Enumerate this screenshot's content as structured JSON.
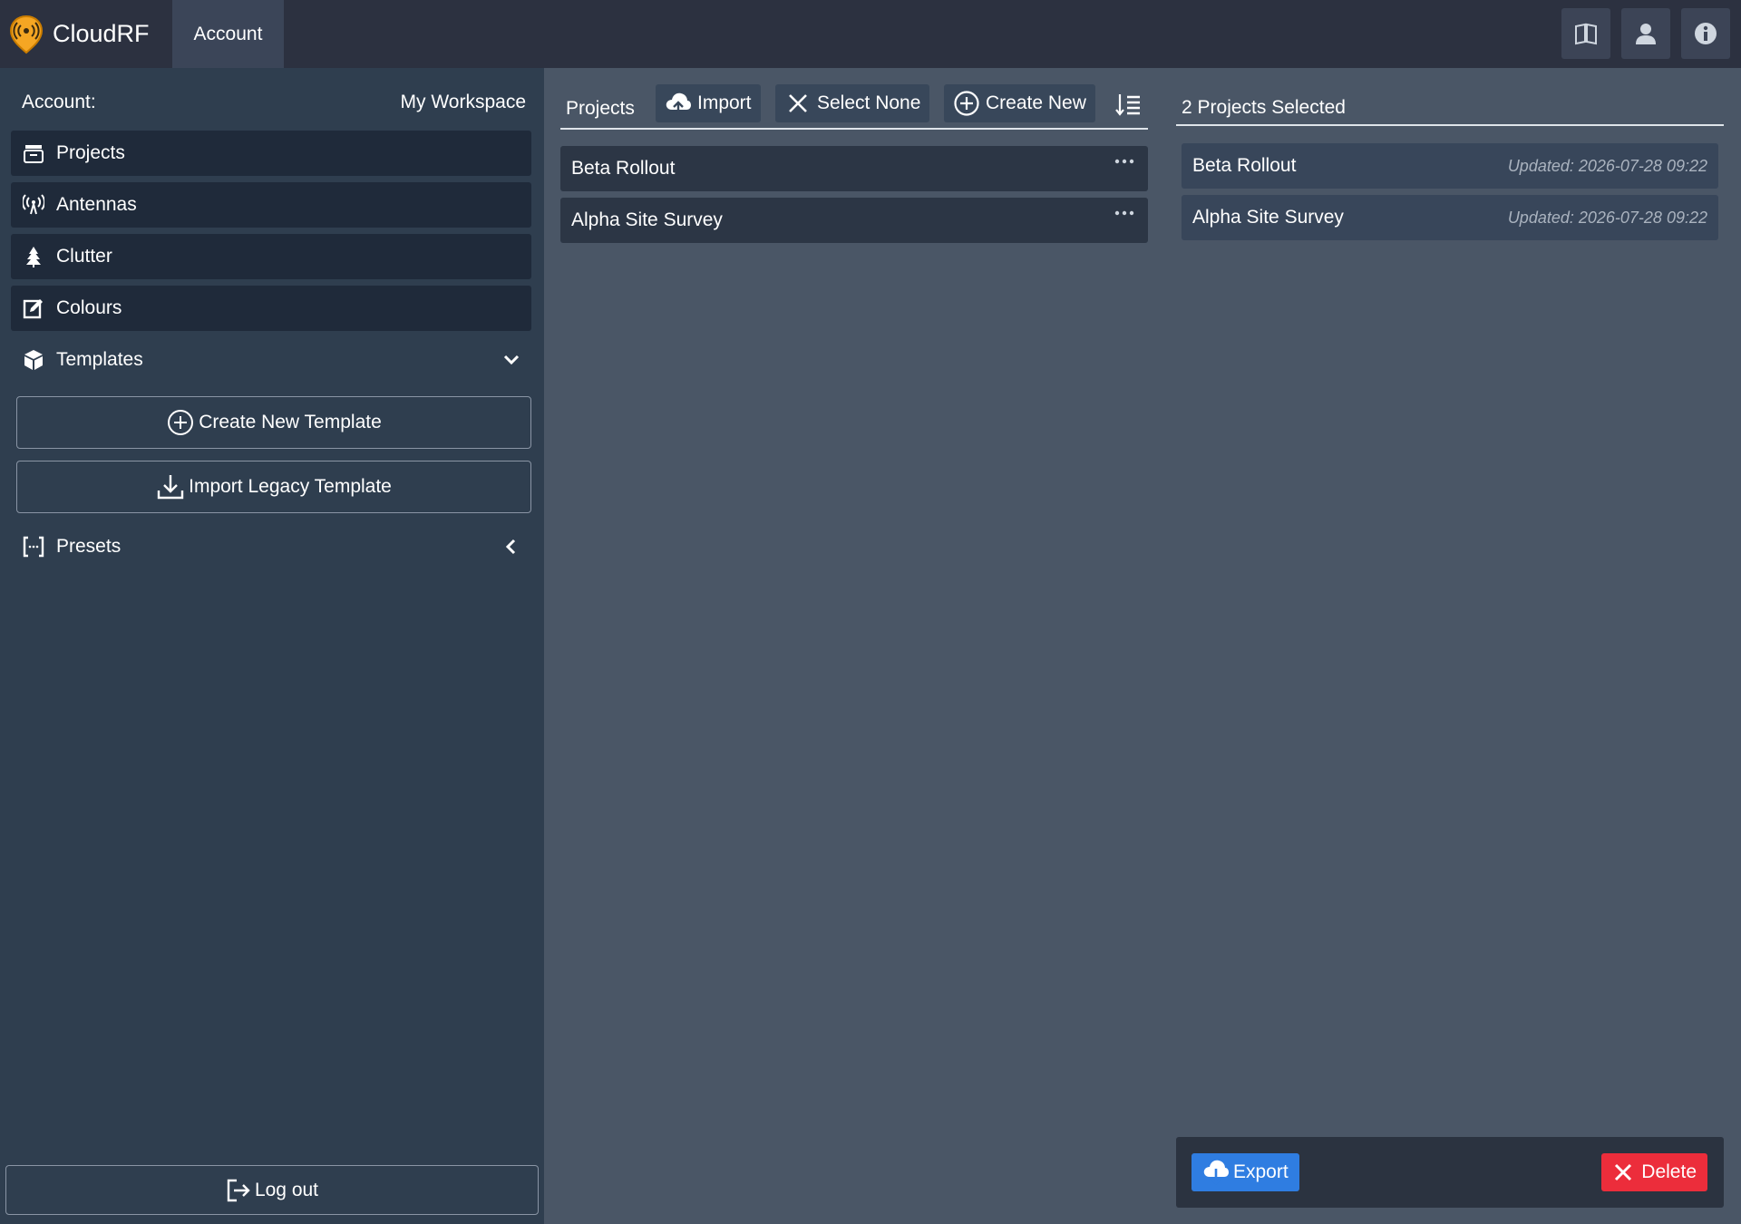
{
  "app": {
    "name": "CloudRF",
    "active_tab": "Account"
  },
  "colors": {
    "accent_orange": "#f5a623",
    "export_blue": "#2f7de1",
    "delete_red": "#ec2d3b"
  },
  "top_icons": [
    "book-icon",
    "user-icon",
    "info-icon"
  ],
  "sidebar": {
    "account_label": "Account:",
    "workspace": "My Workspace",
    "items": [
      {
        "label": "Projects",
        "icon": "archive-icon"
      },
      {
        "label": "Antennas",
        "icon": "antenna-icon"
      },
      {
        "label": "Clutter",
        "icon": "tree-icon"
      },
      {
        "label": "Colours",
        "icon": "edit-icon"
      }
    ],
    "templates": {
      "label": "Templates",
      "create_new": "Create New Template",
      "import_legacy": "Import Legacy Template"
    },
    "presets": {
      "label": "Presets"
    },
    "logout": "Log out"
  },
  "projects_panel": {
    "tab_label": "Projects",
    "import": "Import",
    "select_none": "Select None",
    "create_new": "Create New",
    "rows": [
      {
        "name": "Beta Rollout"
      },
      {
        "name": "Alpha Site Survey"
      }
    ]
  },
  "selection_panel": {
    "header": "2 Projects Selected",
    "rows": [
      {
        "name": "Beta Rollout",
        "updated": "Updated: 2026-07-28 09:22"
      },
      {
        "name": "Alpha Site Survey",
        "updated": "Updated: 2026-07-28 09:22"
      }
    ],
    "export": "Export",
    "delete": "Delete"
  }
}
